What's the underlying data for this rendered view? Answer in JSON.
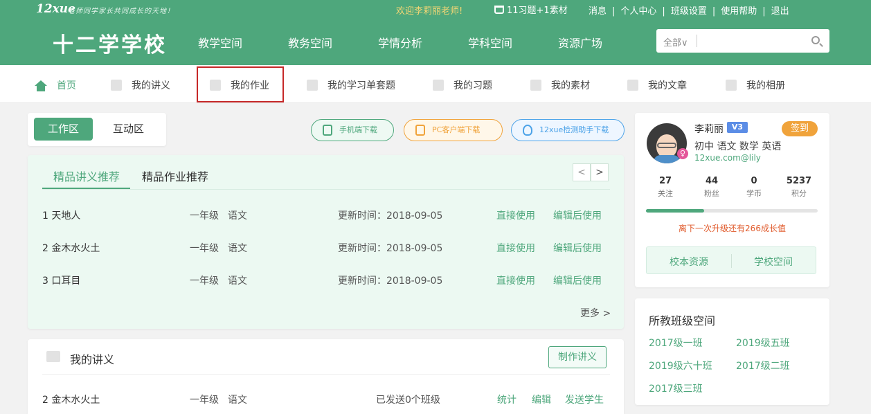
{
  "topbar": {
    "logo_text": "12xue",
    "slogan": "老师同学家长共同成长的天地！",
    "welcome": "欢迎李莉丽老师!",
    "basket": "11习题+1素材",
    "links": [
      "消息",
      "个人中心",
      "班级设置",
      "使用帮助",
      "退出"
    ]
  },
  "header": {
    "school_name": "十二学学校",
    "nav": [
      "教学空间",
      "教务空间",
      "学情分析",
      "学科空间",
      "资源广场"
    ],
    "search": {
      "select_label": "全部∨",
      "placeholder": ""
    }
  },
  "subnav": [
    "首页",
    "我的讲义",
    "我的作业",
    "我的学习单套题",
    "我的习题",
    "我的素材",
    "我的文章",
    "我的相册"
  ],
  "workspace": {
    "tabs": [
      "工作区",
      "互动区"
    ],
    "downloads": [
      "手机端下载",
      "PC客户端下载",
      "12xue检测助手下载"
    ]
  },
  "recommend": {
    "tabs": [
      "精品讲义推荐",
      "精品作业推荐"
    ],
    "pager_prev": "<",
    "pager_next": ">",
    "rows": [
      {
        "title": "1 天地人",
        "grade": "一年级",
        "subject": "语文",
        "date": "更新时间：2018-09-05",
        "use": "直接使用",
        "edit": "编辑后使用"
      },
      {
        "title": "2 金木水火土",
        "grade": "一年级",
        "subject": "语文",
        "date": "更新时间：2018-09-05",
        "use": "直接使用",
        "edit": "编辑后使用"
      },
      {
        "title": "3 口耳目",
        "grade": "一年级",
        "subject": "语文",
        "date": "更新时间：2018-09-05",
        "use": "直接使用",
        "edit": "编辑后使用"
      }
    ],
    "more": "更多 >"
  },
  "my_notes": {
    "title": "我的讲义",
    "make_button": "制作讲义",
    "rows": [
      {
        "title": "2 金木水火土",
        "grade": "一年级",
        "subject": "语文",
        "sent": "已发送0个班级",
        "stats": "统计",
        "edit": "编辑",
        "send": "发送学生"
      }
    ]
  },
  "profile": {
    "name": "李莉丽",
    "level": "V3",
    "sign_button": "签到",
    "gender": "♀",
    "subjects": "初中 语文 数学 英语",
    "account": "12xue.com@lily",
    "stats": [
      {
        "value": "27",
        "label": "关注"
      },
      {
        "value": "44",
        "label": "粉丝"
      },
      {
        "value": "0",
        "label": "学币"
      },
      {
        "value": "5237",
        "label": "积分"
      }
    ],
    "progress_percent": 34,
    "upgrade_text": "离下一次升级还有266成长值",
    "buttons": [
      "校本资源",
      "学校空间"
    ]
  },
  "classes": {
    "title": "所教班级空间",
    "items": [
      "2017级一班",
      "2019级五班",
      "2019级六十班",
      "2017级二班",
      "2017级三班"
    ]
  },
  "colors": {
    "brand": "#4ea77c",
    "highlight_border": "#c62828",
    "warning": "#f0a33b"
  }
}
